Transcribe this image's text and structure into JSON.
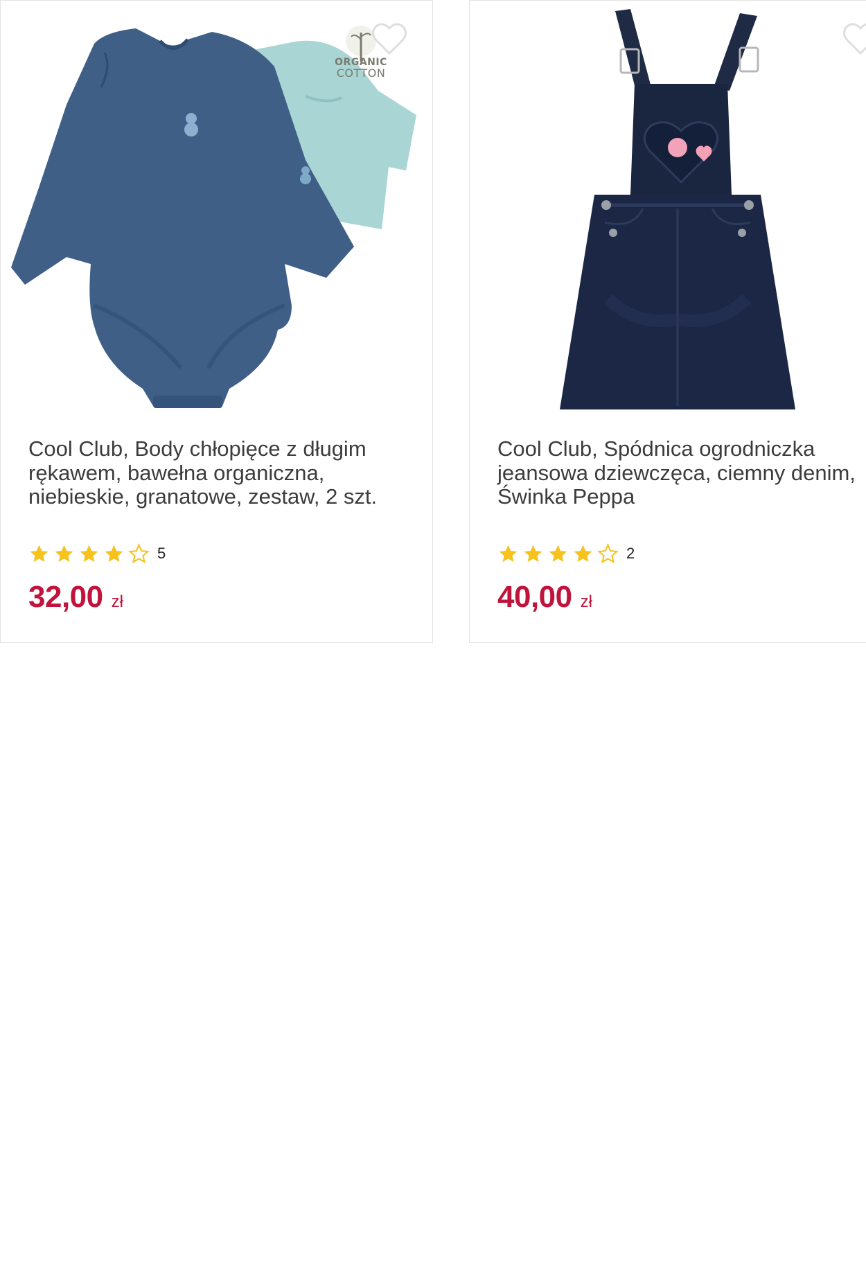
{
  "products": [
    {
      "name": "Cool Club, Body chłopięce z długim rękawem, bawełna organiczna, niebieskie, granatowe, zestaw, 2 szt.",
      "badge": {
        "line1": "ORGANIC",
        "line2": "COTTON"
      },
      "rating": 4,
      "rating_max": 5,
      "review_count": "5",
      "price": "32,00",
      "currency": "zł"
    },
    {
      "name": "Cool Club, Spódnica ogrodniczka jeansowa dziewczęca, ciemny denim, Świnka Peppa",
      "rating": 4,
      "rating_max": 5,
      "review_count": "2",
      "price": "40,00",
      "currency": "zł"
    }
  ],
  "icons": {
    "favorite": "heart-outline-icon",
    "star_full": "star-filled-icon",
    "star_empty": "star-outline-icon"
  },
  "colors": {
    "price": "#c0143c",
    "star": "#f6c21b",
    "title": "#3c3c3c",
    "border": "#e3e3e3"
  }
}
